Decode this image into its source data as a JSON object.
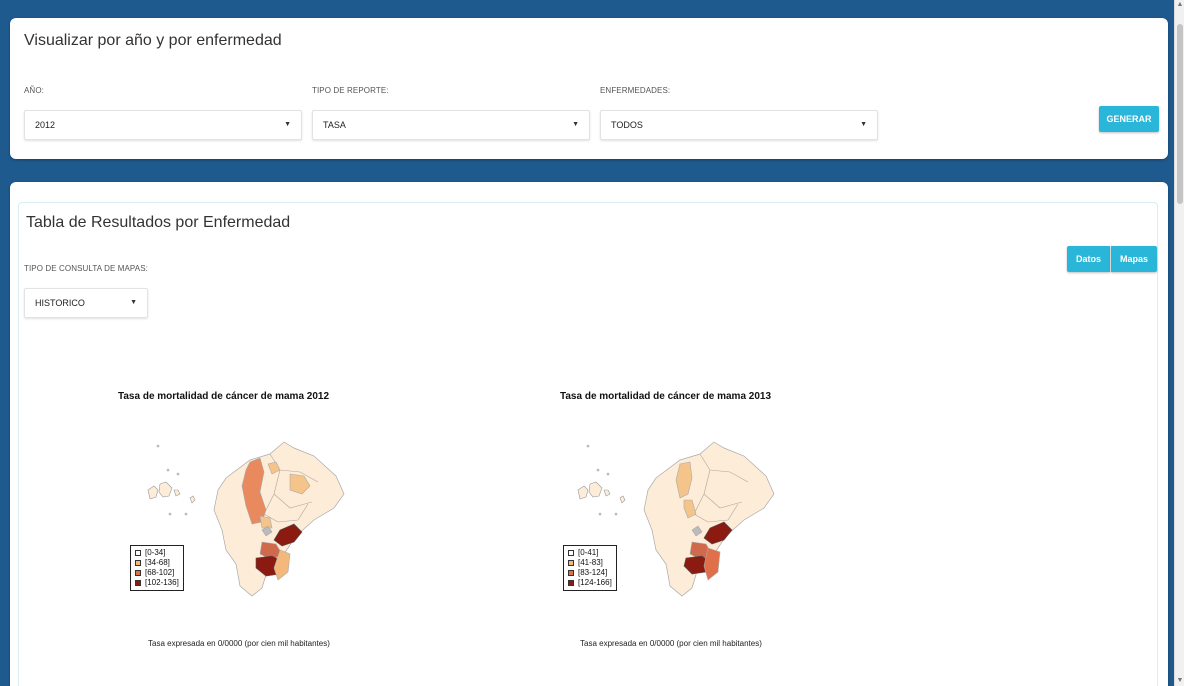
{
  "top_panel": {
    "title": "Visualizar por año y por enfermedad",
    "fields": [
      {
        "label": "AÑO:",
        "value": "2012"
      },
      {
        "label": "TIPO DE REPORTE:",
        "value": "TASA"
      },
      {
        "label": "ENFERMEDADES:",
        "value": "TODOS"
      }
    ],
    "generate_label": "GENERAR"
  },
  "results_panel": {
    "title": "Tabla de Resultados por Enfermedad",
    "consulta_label": "TIPO DE CONSULTA DE MAPAS:",
    "consulta_value": "HISTORICO",
    "datos_label": "Datos",
    "mapas_label": "Mapas"
  },
  "maps": [
    {
      "title": "Tasa de mortalidad de cáncer de mama 2012",
      "legend": [
        "[0-34]",
        "[34-68]",
        "[68-102]",
        "[102-136]"
      ],
      "caption": "Tasa expresada en 0/0000 (por cien mil habitantes)"
    },
    {
      "title": "Tasa de mortalidad de cáncer de mama 2013",
      "legend": [
        "[0-41]",
        "[41-83]",
        "[83-124]",
        "[124-166]"
      ],
      "caption": "Tasa expresada en 0/0000 (por cien mil habitantes)"
    }
  ],
  "colors": {
    "accent": "#29b6d9",
    "background": "#1f5a8f",
    "legend_fill": [
      "#fdecd8",
      "#f4b87a",
      "#e0704a",
      "#8b1a10"
    ]
  }
}
